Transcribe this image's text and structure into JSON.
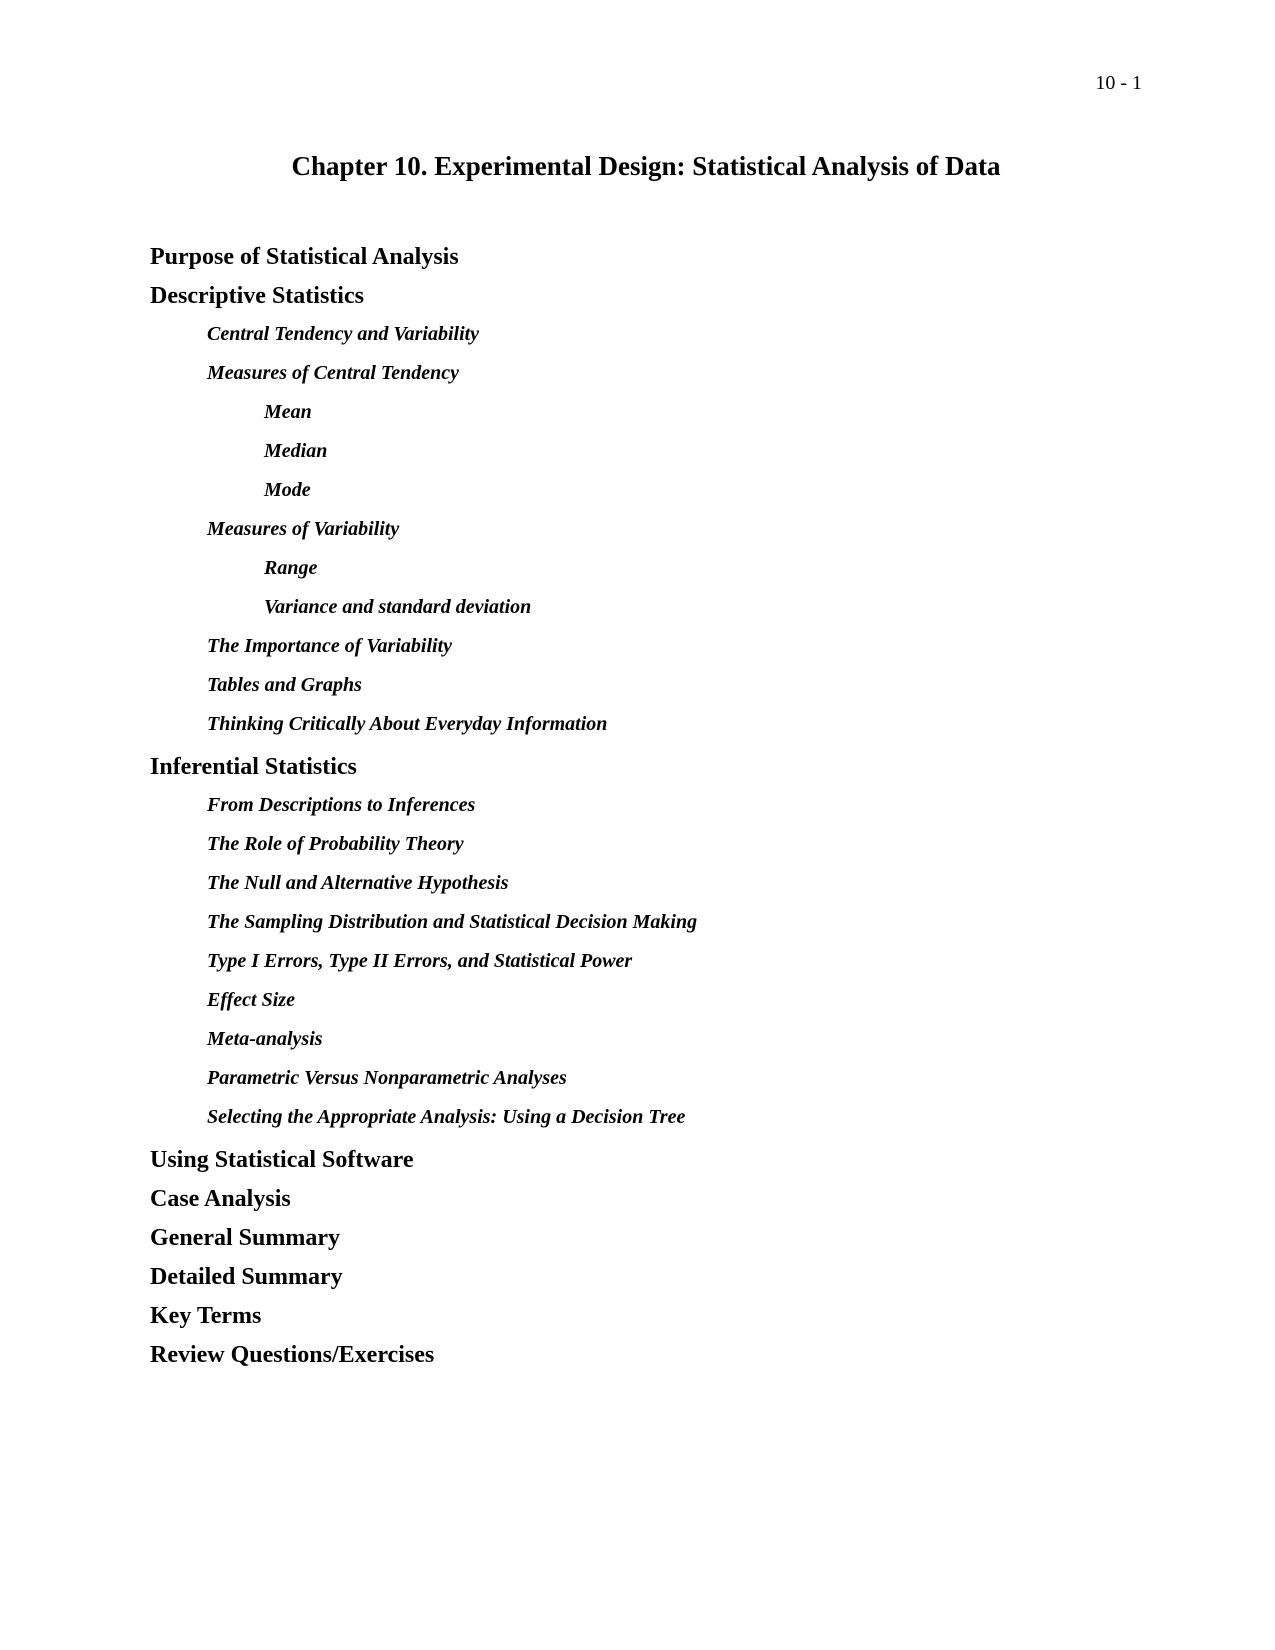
{
  "pageNumber": "10 - 1",
  "chapterTitle": "Chapter 10. Experimental Design: Statistical Analysis of Data",
  "sections": {
    "s1": "Purpose of Statistical Analysis",
    "s2": "Descriptive Statistics",
    "s3": "Inferential Statistics",
    "s4": "Using Statistical Software",
    "s5": "Case Analysis",
    "s6": "General Summary",
    "s7": "Detailed Summary",
    "s8": "Key Terms",
    "s9": "Review Questions/Exercises"
  },
  "descriptive": {
    "e1": "Central Tendency and Variability",
    "e2": "Measures of Central Tendency",
    "e2a": "Mean",
    "e2b": "Median",
    "e2c": "Mode",
    "e3": "Measures of Variability",
    "e3a": "Range",
    "e3b": "Variance and standard deviation",
    "e4": "The Importance of Variability",
    "e5": "Tables and Graphs",
    "e6": "Thinking Critically About Everyday Information"
  },
  "inferential": {
    "e1": "From Descriptions to Inferences",
    "e2": "The Role of Probability Theory",
    "e3": "The Null and Alternative Hypothesis",
    "e4": "The Sampling Distribution and Statistical Decision Making",
    "e5": "Type I Errors, Type II Errors, and Statistical Power",
    "e6": "Effect Size",
    "e7": "Meta-analysis",
    "e8": "Parametric Versus Nonparametric Analyses",
    "e9": "Selecting the Appropriate Analysis: Using a Decision Tree"
  }
}
